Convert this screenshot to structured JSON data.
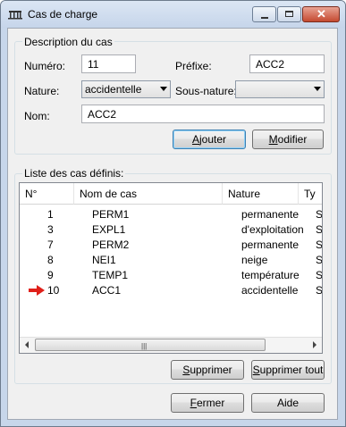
{
  "window": {
    "title": "Cas de charge"
  },
  "description": {
    "legend": "Description du cas",
    "numero_label": "Numéro:",
    "numero_value": "11",
    "prefixe_label": "Préfixe:",
    "prefixe_value": "ACC2",
    "nature_label": "Nature:",
    "nature_value": "accidentelle",
    "sous_nature_label": "Sous-nature:",
    "sous_nature_value": "",
    "nom_label": "Nom:",
    "nom_value": "ACC2",
    "ajouter_mnemonic": "A",
    "ajouter_rest": "jouter",
    "modifier_mnemonic": "M",
    "modifier_rest": "odifier"
  },
  "list": {
    "legend": "Liste des cas définis:",
    "columns": [
      "N°",
      "Nom de cas",
      "Nature",
      "Ty"
    ],
    "rows": [
      {
        "num": "1",
        "name": "PERM1",
        "nature": "permanente",
        "type": "St"
      },
      {
        "num": "3",
        "name": "EXPL1",
        "nature": "d'exploitation",
        "type": "St"
      },
      {
        "num": "7",
        "name": "PERM2",
        "nature": "permanente",
        "type": "St"
      },
      {
        "num": "8",
        "name": "NEI1",
        "nature": "neige",
        "type": "St"
      },
      {
        "num": "9",
        "name": "TEMP1",
        "nature": "température",
        "type": "St"
      },
      {
        "num": "10",
        "name": "ACC1",
        "nature": "accidentelle",
        "type": "St"
      }
    ],
    "current_row_icon": "red-arrow-icon",
    "supprimer_mnemonic": "S",
    "supprimer_rest": "upprimer",
    "supprimer_tout_mnemonic": "S",
    "supprimer_tout_rest": "upprimer tout"
  },
  "footer": {
    "fermer_mnemonic": "F",
    "fermer_rest": "ermer",
    "aide_label": "Aide"
  },
  "colors": {
    "accent_arrow": "#e0201a",
    "title_bg": "#c7d6ea"
  }
}
